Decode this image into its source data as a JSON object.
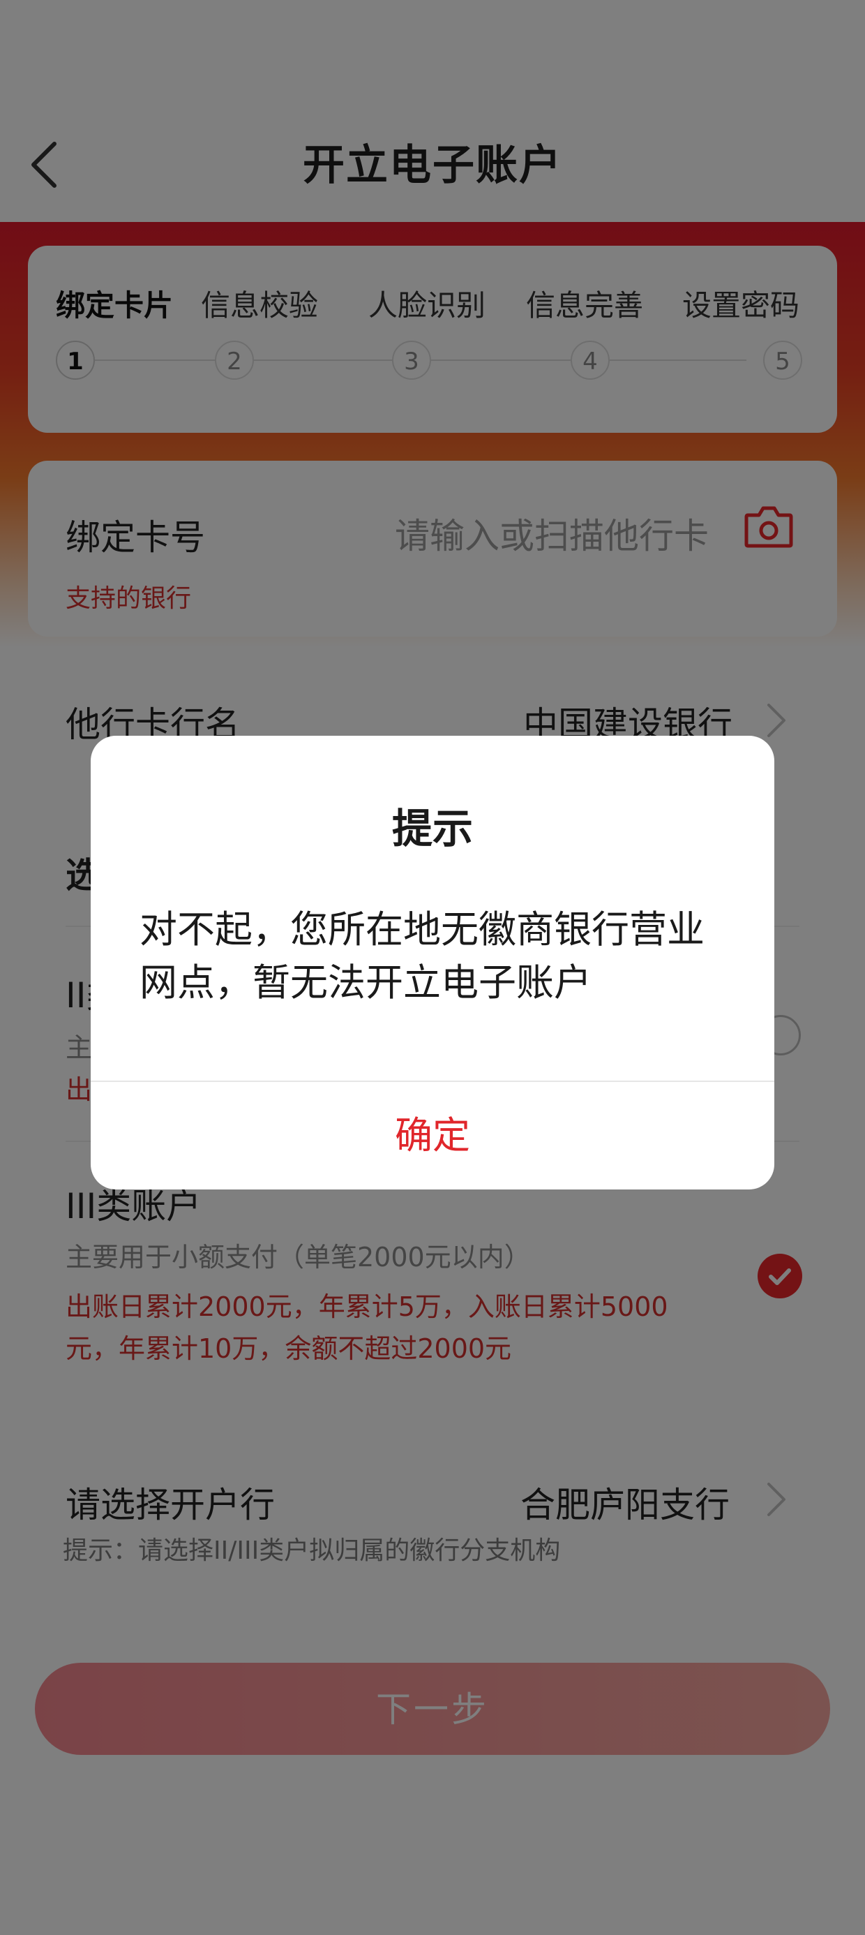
{
  "header": {
    "title": "开立电子账户"
  },
  "steps": [
    {
      "label": "绑定卡片",
      "num": "1"
    },
    {
      "label": "信息校验",
      "num": "2"
    },
    {
      "label": "人脸识别",
      "num": "3"
    },
    {
      "label": "信息完善",
      "num": "4"
    },
    {
      "label": "设置密码",
      "num": "5"
    }
  ],
  "current_step": 1,
  "card_bind": {
    "label": "绑定卡号",
    "placeholder": "请输入或扫描他行卡",
    "supported_banks_link": "支持的银行"
  },
  "bank_name": {
    "label": "他行卡行名",
    "value": "中国建设银行"
  },
  "account_select": {
    "title_partial": "选",
    "class2": {
      "title_partial": "II类",
      "desc_partial": "主",
      "limit_partial": "出"
    },
    "class3": {
      "title": "III类账户",
      "desc": "主要用于小额支付（单笔2000元以内）",
      "limits": "出账日累计2000元，年累计5万，入账日累计5000元，年累计10万，余额不超过2000元",
      "selected": true
    }
  },
  "branch": {
    "label": "请选择开户行",
    "value": "合肥庐阳支行",
    "hint": "提示：请选择II/III类户拟归属的徽行分支机构"
  },
  "next_button": "下一步",
  "dialog": {
    "title": "提示",
    "message": "对不起，您所在地无徽商银行营业网点，暂无法开立电子账户",
    "confirm": "确定"
  },
  "colors": {
    "accent": "#e8262b",
    "link_red": "#d3302f"
  }
}
